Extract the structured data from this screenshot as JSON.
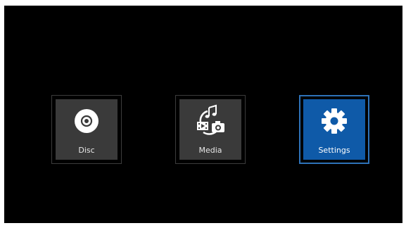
{
  "menu": {
    "items": [
      {
        "label": "Disc",
        "icon": "disc-icon"
      },
      {
        "label": "Media",
        "icon": "media-icon"
      },
      {
        "label": "Settings",
        "icon": "gear-icon",
        "selected": true
      }
    ]
  },
  "colors": {
    "background": "#000000",
    "tile": "#3a3a3a",
    "tile_border": "#3c3c3c",
    "selected_tile": "#0f5aa8",
    "selected_border": "#2e72b8"
  }
}
